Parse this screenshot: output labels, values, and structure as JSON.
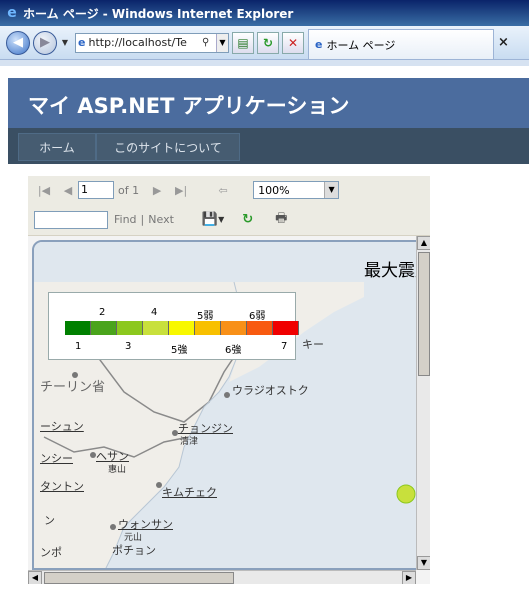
{
  "window": {
    "title": "ホーム ページ - Windows Internet Explorer"
  },
  "toolbar": {
    "url": "http://localhost/Te",
    "tab_label": "ホーム ページ",
    "tab_close": "×"
  },
  "site": {
    "title": "マイ ASP.NET アプリケーション",
    "menu": [
      "ホーム",
      "このサイトについて"
    ]
  },
  "viewer": {
    "page_current": "1",
    "page_of": "of 1",
    "zoom": "100%",
    "find_label": "Find",
    "separator": "|",
    "next_label": "Next"
  },
  "map": {
    "title": "最大震度",
    "legend_top": [
      "2",
      "4",
      "5弱",
      "6弱"
    ],
    "legend_bottom": [
      "1",
      "3",
      "5強",
      "6強",
      "7"
    ],
    "legend_colors": [
      "#008000",
      "#4aa41c",
      "#8cc81e",
      "#c8e03c",
      "#f8f800",
      "#f8c000",
      "#f89018",
      "#f85a10",
      "#f00000"
    ],
    "places": [
      {
        "name": "キー",
        "underline": false
      },
      {
        "name": "チーリン省",
        "underline": false
      },
      {
        "name": "ウラジオストク",
        "underline": false
      },
      {
        "name": "ーシュン",
        "underline": true
      },
      {
        "name": "チョンジン",
        "underline": true
      },
      {
        "name": "清津",
        "underline": false
      },
      {
        "name": "ンシー",
        "underline": true
      },
      {
        "name": "ヘサン",
        "underline": true
      },
      {
        "name": "惠山",
        "underline": false
      },
      {
        "name": "タントン",
        "underline": true
      },
      {
        "name": "キムチェク",
        "underline": true
      },
      {
        "name": "ン",
        "underline": false
      },
      {
        "name": "ウォンサン",
        "underline": true
      },
      {
        "name": "元山",
        "underline": false
      },
      {
        "name": "ンポ",
        "underline": false
      },
      {
        "name": "ポチョン",
        "underline": false
      }
    ]
  }
}
